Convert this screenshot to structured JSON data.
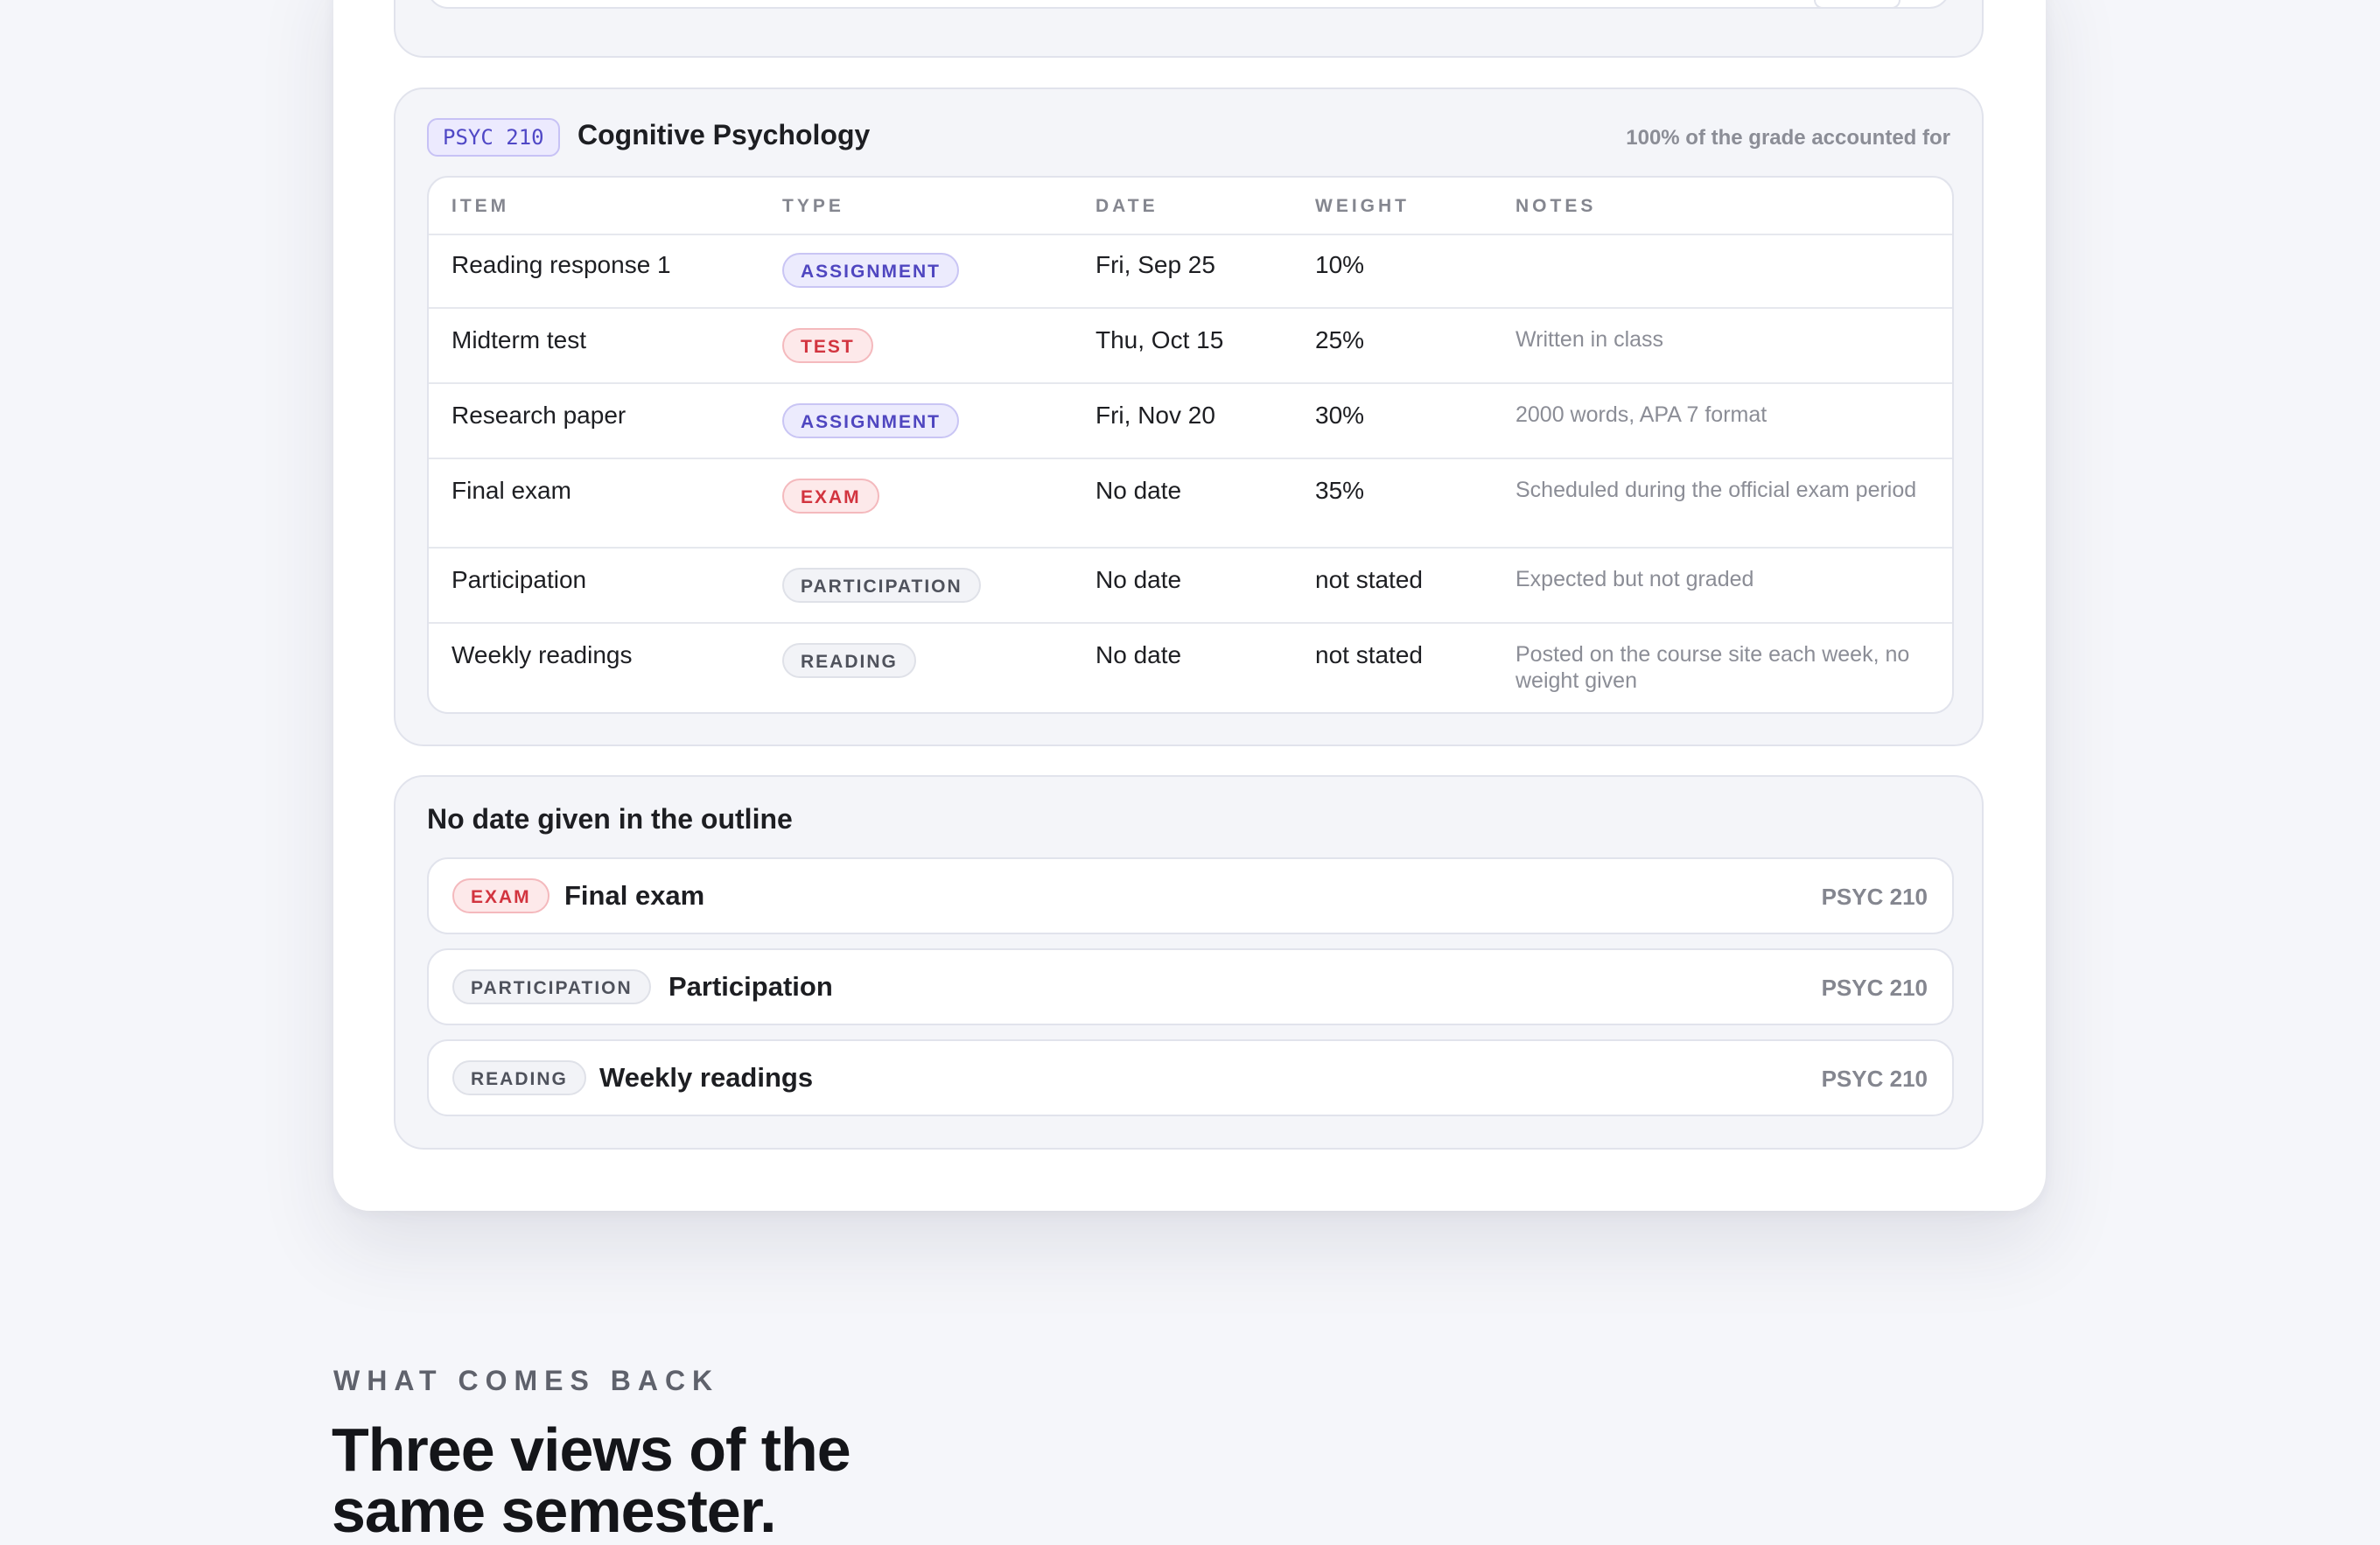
{
  "course": {
    "code": "PSYC 210",
    "title": "Cognitive Psychology",
    "coverage_note": "100% of the grade accounted for",
    "columns": [
      "ITEM",
      "TYPE",
      "DATE",
      "WEIGHT",
      "NOTES"
    ],
    "rows": [
      {
        "item": "Reading response 1",
        "type": "ASSIGNMENT",
        "date": "Fri, Sep 25",
        "weight": "10%",
        "notes": ""
      },
      {
        "item": "Midterm test",
        "type": "TEST",
        "date": "Thu, Oct 15",
        "weight": "25%",
        "notes": "Written in class"
      },
      {
        "item": "Research paper",
        "type": "ASSIGNMENT",
        "date": "Fri, Nov 20",
        "weight": "30%",
        "notes": "2000 words, APA 7 format"
      },
      {
        "item": "Final exam",
        "type": "EXAM",
        "date": "No date",
        "weight": "35%",
        "notes": "Scheduled during the official exam period"
      },
      {
        "item": "Participation",
        "type": "PARTICIPATION",
        "date": "No date",
        "weight": "not stated",
        "notes": "Expected but not graded"
      },
      {
        "item": "Weekly readings",
        "type": "READING",
        "date": "No date",
        "weight": "not stated",
        "notes": "Posted on the course site each week, no weight given"
      }
    ]
  },
  "no_date": {
    "title": "No date given in the outline",
    "items": [
      {
        "type": "EXAM",
        "name": "Final exam",
        "course": "PSYC 210"
      },
      {
        "type": "PARTICIPATION",
        "name": "Participation",
        "course": "PSYC 210"
      },
      {
        "type": "READING",
        "name": "Weekly readings",
        "course": "PSYC 210"
      }
    ]
  },
  "section": {
    "eyebrow": "WHAT COMES BACK",
    "headline": "Three views of the same semester."
  },
  "colors": {
    "assignment": "#4f46c0",
    "exam": "#d2343f",
    "neutral": "#4f525c"
  }
}
